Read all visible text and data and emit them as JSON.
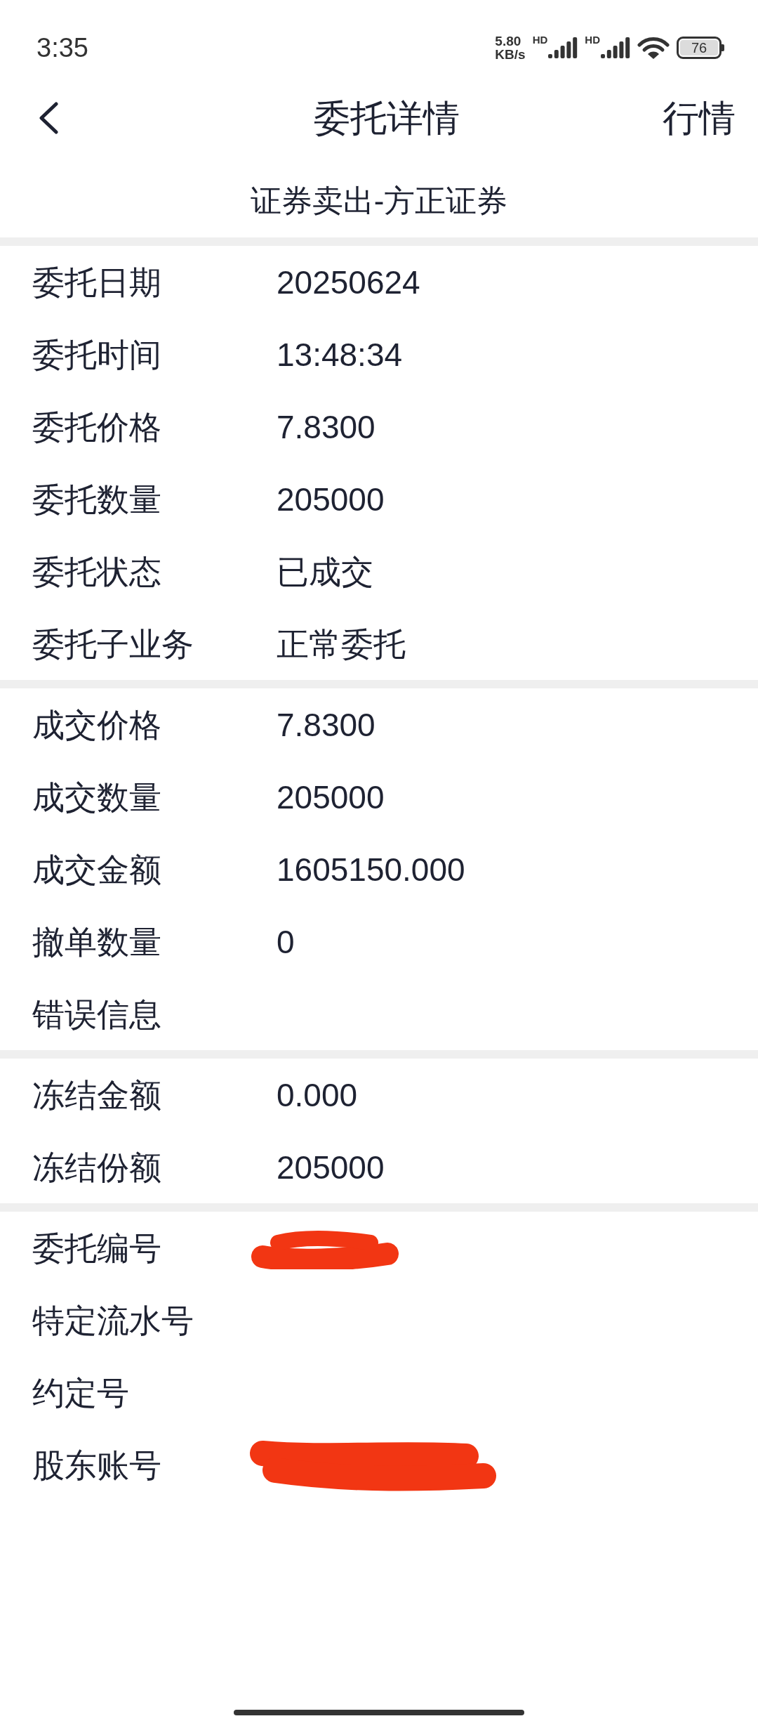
{
  "status_bar": {
    "time": "3:35",
    "net_speed": "5.80",
    "net_unit": "KB/s",
    "sim_labels": [
      "HD",
      "HD"
    ],
    "battery": "76"
  },
  "header": {
    "title": "委托详情",
    "action": "行情"
  },
  "subtitle": "证券卖出-方正证券",
  "sections": [
    {
      "rows": [
        {
          "label": "委托日期",
          "value": "20250624"
        },
        {
          "label": "委托时间",
          "value": "13:48:34"
        },
        {
          "label": "委托价格",
          "value": "7.8300"
        },
        {
          "label": "委托数量",
          "value": "205000"
        },
        {
          "label": "委托状态",
          "value": "已成交"
        },
        {
          "label": "委托子业务",
          "value": "正常委托"
        }
      ]
    },
    {
      "rows": [
        {
          "label": "成交价格",
          "value": "7.8300"
        },
        {
          "label": "成交数量",
          "value": "205000"
        },
        {
          "label": "成交金额",
          "value": "1605150.000"
        },
        {
          "label": "撤单数量",
          "value": "0"
        },
        {
          "label": "错误信息"
        }
      ]
    },
    {
      "rows": [
        {
          "label": "冻结金额",
          "value": "0.000"
        },
        {
          "label": "冻结份额",
          "value": "205000"
        }
      ]
    },
    {
      "rows": [
        {
          "label": "委托编号",
          "redacted": true
        },
        {
          "label": "特定流水号"
        },
        {
          "label": "约定号"
        },
        {
          "label": "股东账号",
          "redacted": true
        }
      ]
    }
  ]
}
